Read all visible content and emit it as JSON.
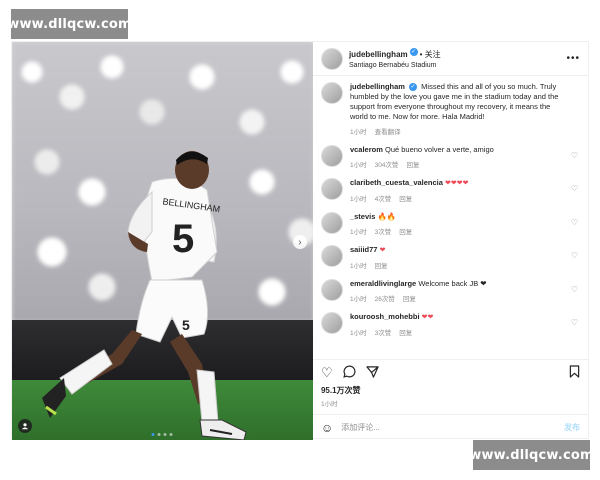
{
  "watermark": {
    "top": "www.dllqcw.com",
    "bottom": "www.dllqcw.com"
  },
  "post": {
    "author": "judebellingham",
    "follow_label": "关注",
    "location": "Santiago Bernabéu Stadium",
    "more_icon": "more-icon",
    "photo": {
      "jersey_number": "5",
      "jersey_name": "BELLINGHAM",
      "slide_count": 4,
      "active_slide": 1
    },
    "caption": {
      "user": "judebellingham",
      "text": "Missed this and all of you so much. Truly humbled by the love you gave me in the stadium today and the support from everyone throughout my recovery, it means the world to me. Now for more. Hala Madrid!",
      "time": "1小时",
      "translate": "查看翻译"
    },
    "comments": [
      {
        "user": "vcalerom",
        "text": "Qué bueno volver a verte, amigo",
        "time": "1小时",
        "likes": "304次赞",
        "reply": "回复"
      },
      {
        "user": "claribeth_cuesta_valencia",
        "text": "❤❤❤❤",
        "time": "1小时",
        "likes": "4次赞",
        "reply": "回复"
      },
      {
        "user": "_stevis",
        "text": "🔥🔥",
        "time": "1小时",
        "likes": "3次赞",
        "reply": "回复"
      },
      {
        "user": "saiiid77",
        "text": "❤",
        "time": "1小时",
        "likes": "",
        "reply": "回复"
      },
      {
        "user": "emeraldlivinglarge",
        "text": "Welcome back JB ❤",
        "time": "1小时",
        "likes": "26次赞",
        "reply": "回复"
      },
      {
        "user": "kouroosh_mohebbi",
        "text": "❤❤",
        "time": "1小时",
        "likes": "3次赞",
        "reply": "回复"
      }
    ],
    "likes": "95.1万次赞",
    "date": "1小时",
    "add_comment_placeholder": "添加评论...",
    "post_button": "发布"
  }
}
